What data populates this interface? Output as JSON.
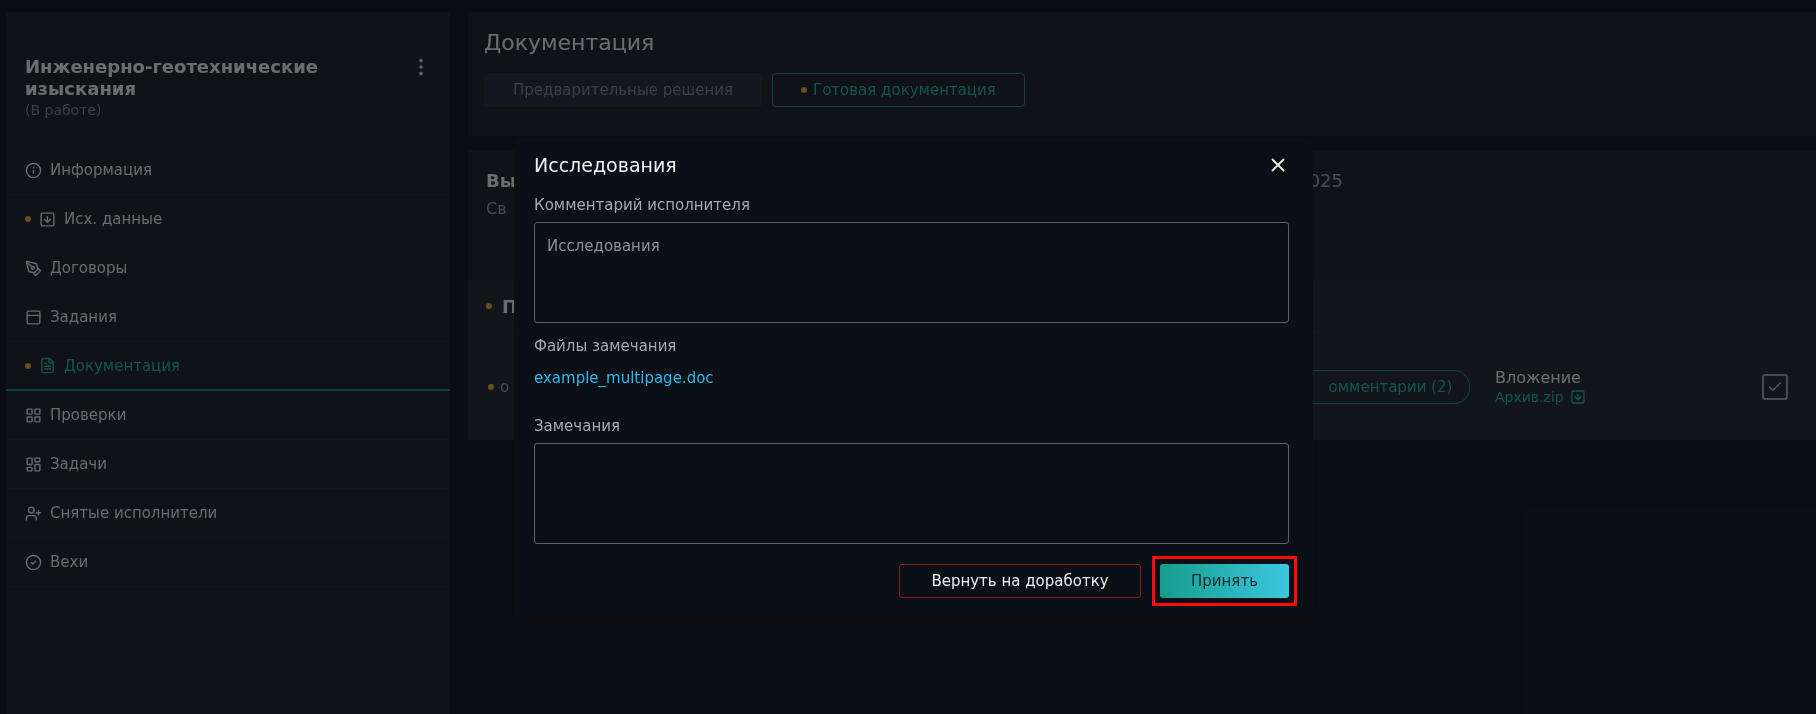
{
  "sidebar": {
    "title": "Инженерно-геотехнические изыскания",
    "status": "(В работе)",
    "items": [
      {
        "label": "Информация",
        "marked": false,
        "selected": false
      },
      {
        "label": "Исх. данные",
        "marked": true,
        "selected": false
      },
      {
        "label": "Договоры",
        "marked": false,
        "selected": false
      },
      {
        "label": "Задания",
        "marked": false,
        "selected": false
      },
      {
        "label": "Документация",
        "marked": true,
        "selected": true
      },
      {
        "label": "Проверки",
        "marked": false,
        "selected": false
      },
      {
        "label": "Задачи",
        "marked": false,
        "selected": false
      },
      {
        "label": "Снятые исполнители",
        "marked": false,
        "selected": false
      },
      {
        "label": "Вехи",
        "marked": false,
        "selected": false
      }
    ]
  },
  "main": {
    "title": "Документация",
    "tabs": [
      {
        "label": "Предварительные решения",
        "selected": false,
        "marked": false
      },
      {
        "label": "Готовая документация",
        "selected": true,
        "marked": true
      }
    ],
    "card": {
      "heading": "Вы",
      "subheading": "Св",
      "date": "025",
      "section": {
        "label": "П",
        "marked": true
      },
      "row": {
        "text": "о",
        "marked": true,
        "comments": "омментарии (2)",
        "attachment_label": "Вложение",
        "attachment_file": "Архив.zip",
        "checked": true
      }
    }
  },
  "modal": {
    "title": "Исследования",
    "comment_label": "Комментарий исполнителя",
    "comment_value": "Исследования",
    "files_label": "Файлы замечания",
    "files": [
      "example_multipage.doc"
    ],
    "remarks_label": "Замечания",
    "buttons": [
      {
        "label": "Вернуть на доработку",
        "kind": "outline",
        "highlighted": false
      },
      {
        "label": "Принять",
        "kind": "primary",
        "highlighted": true
      }
    ]
  }
}
